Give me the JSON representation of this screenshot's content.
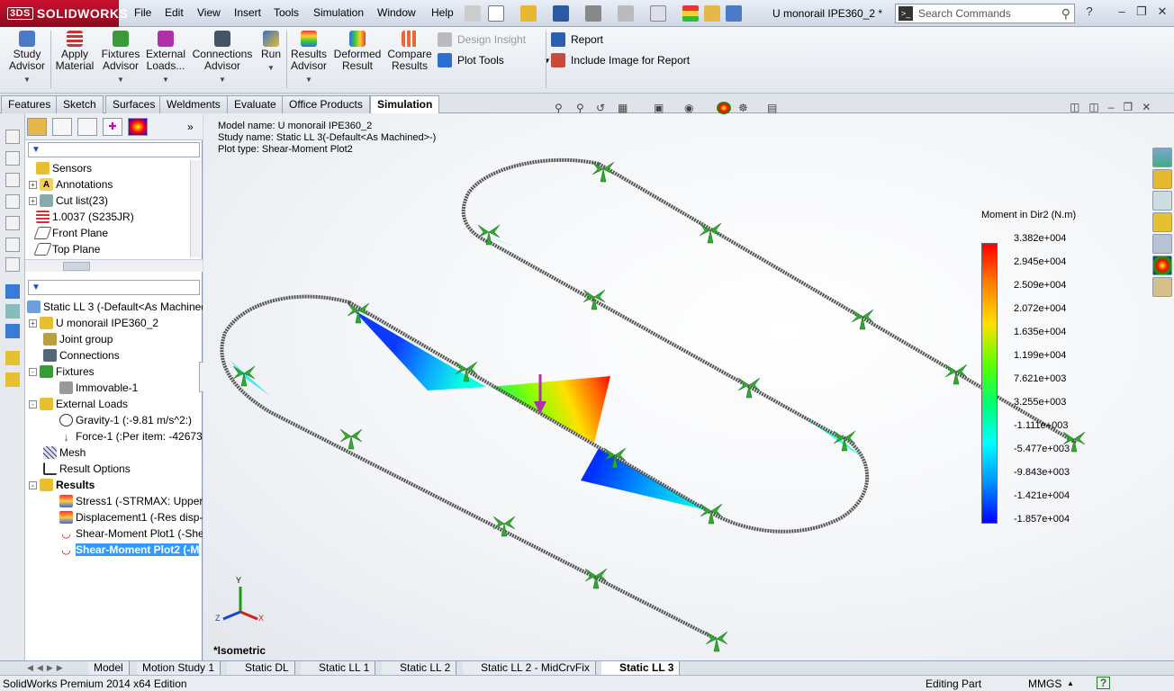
{
  "app": {
    "logo": "SOLIDWORKS",
    "logo_prefix": "3DS",
    "doc_title": "U monorail IPE360_2 *"
  },
  "menu": [
    "File",
    "Edit",
    "View",
    "Insert",
    "Tools",
    "Simulation",
    "Window",
    "Help"
  ],
  "search": {
    "placeholder": "Search Commands"
  },
  "ribbon": {
    "study_advisor": "Study Advisor",
    "apply_material": "Apply Material",
    "fixtures_advisor": "Fixtures Advisor",
    "external_loads": "External Loads...",
    "connections_advisor": "Connections Advisor",
    "run": "Run",
    "results_advisor": "Results Advisor",
    "deformed_result": "Deformed Result",
    "compare_results": "Compare Results",
    "design_insight": "Design Insight",
    "plot_tools": "Plot Tools",
    "report": "Report",
    "include_image": "Include Image for Report"
  },
  "command_tabs": [
    "Features",
    "Sketch",
    "Surfaces",
    "Weldments",
    "Evaluate",
    "Office Products",
    "Simulation"
  ],
  "feature_tree": [
    "Sensors",
    "Annotations",
    "Cut list(23)",
    "1.0037 (S235JR)",
    "Front Plane",
    "Top Plane"
  ],
  "study_tree": {
    "study": "Static LL 3 (-Default<As Machined>-)",
    "part": "U monorail IPE360_2",
    "joint_group": "Joint group",
    "connections": "Connections",
    "fixtures": "Fixtures",
    "immovable": "Immovable-1",
    "external_loads": "External Loads",
    "gravity": "Gravity-1 (:-9.81 m/s^2:)",
    "force": "Force-1 (:Per item: -42673.",
    "mesh": "Mesh",
    "result_options": "Result Options",
    "results": "Results",
    "stress": "Stress1 (-STRMAX: Upper b",
    "displacement": "Displacement1 (-Res disp-",
    "shear1": "Shear-Moment Plot1 (-She",
    "shear2": "Shear-Moment Plot2 (-M"
  },
  "viewport_info": {
    "model": "Model name: U monorail IPE360_2",
    "study": "Study name: Static LL 3(-Default<As Machined>-)",
    "plot": "Plot type:  Shear-Moment Plot2"
  },
  "view_name": "*Isometric",
  "triad": {
    "y": "Y",
    "x": "X",
    "z": "Z"
  },
  "legend": {
    "title": "Moment in Dir2 (N.m)",
    "ticks": [
      "3.382e+004",
      "2.945e+004",
      "2.509e+004",
      "2.072e+004",
      "1.635e+004",
      "1.199e+004",
      "7.621e+003",
      "3.255e+003",
      "-1.111e+003",
      "-5.477e+003",
      "-9.843e+003",
      "-1.421e+004",
      "-1.857e+004"
    ],
    "colors": [
      "#ff0000",
      "#ff8000",
      "#ffe000",
      "#60ff00",
      "#00ff70",
      "#00ffff",
      "#0090ff",
      "#0000ff"
    ]
  },
  "bottom_tabs": [
    "Model",
    "Motion Study 1",
    "Static DL",
    "Static LL 1",
    "Static LL 2",
    "Static LL 2 - MidCrvFix",
    "Static LL 3"
  ],
  "status": {
    "edition": "SolidWorks Premium 2014 x64 Edition",
    "mode": "Editing Part",
    "units": "MMGS",
    "help": "?"
  }
}
